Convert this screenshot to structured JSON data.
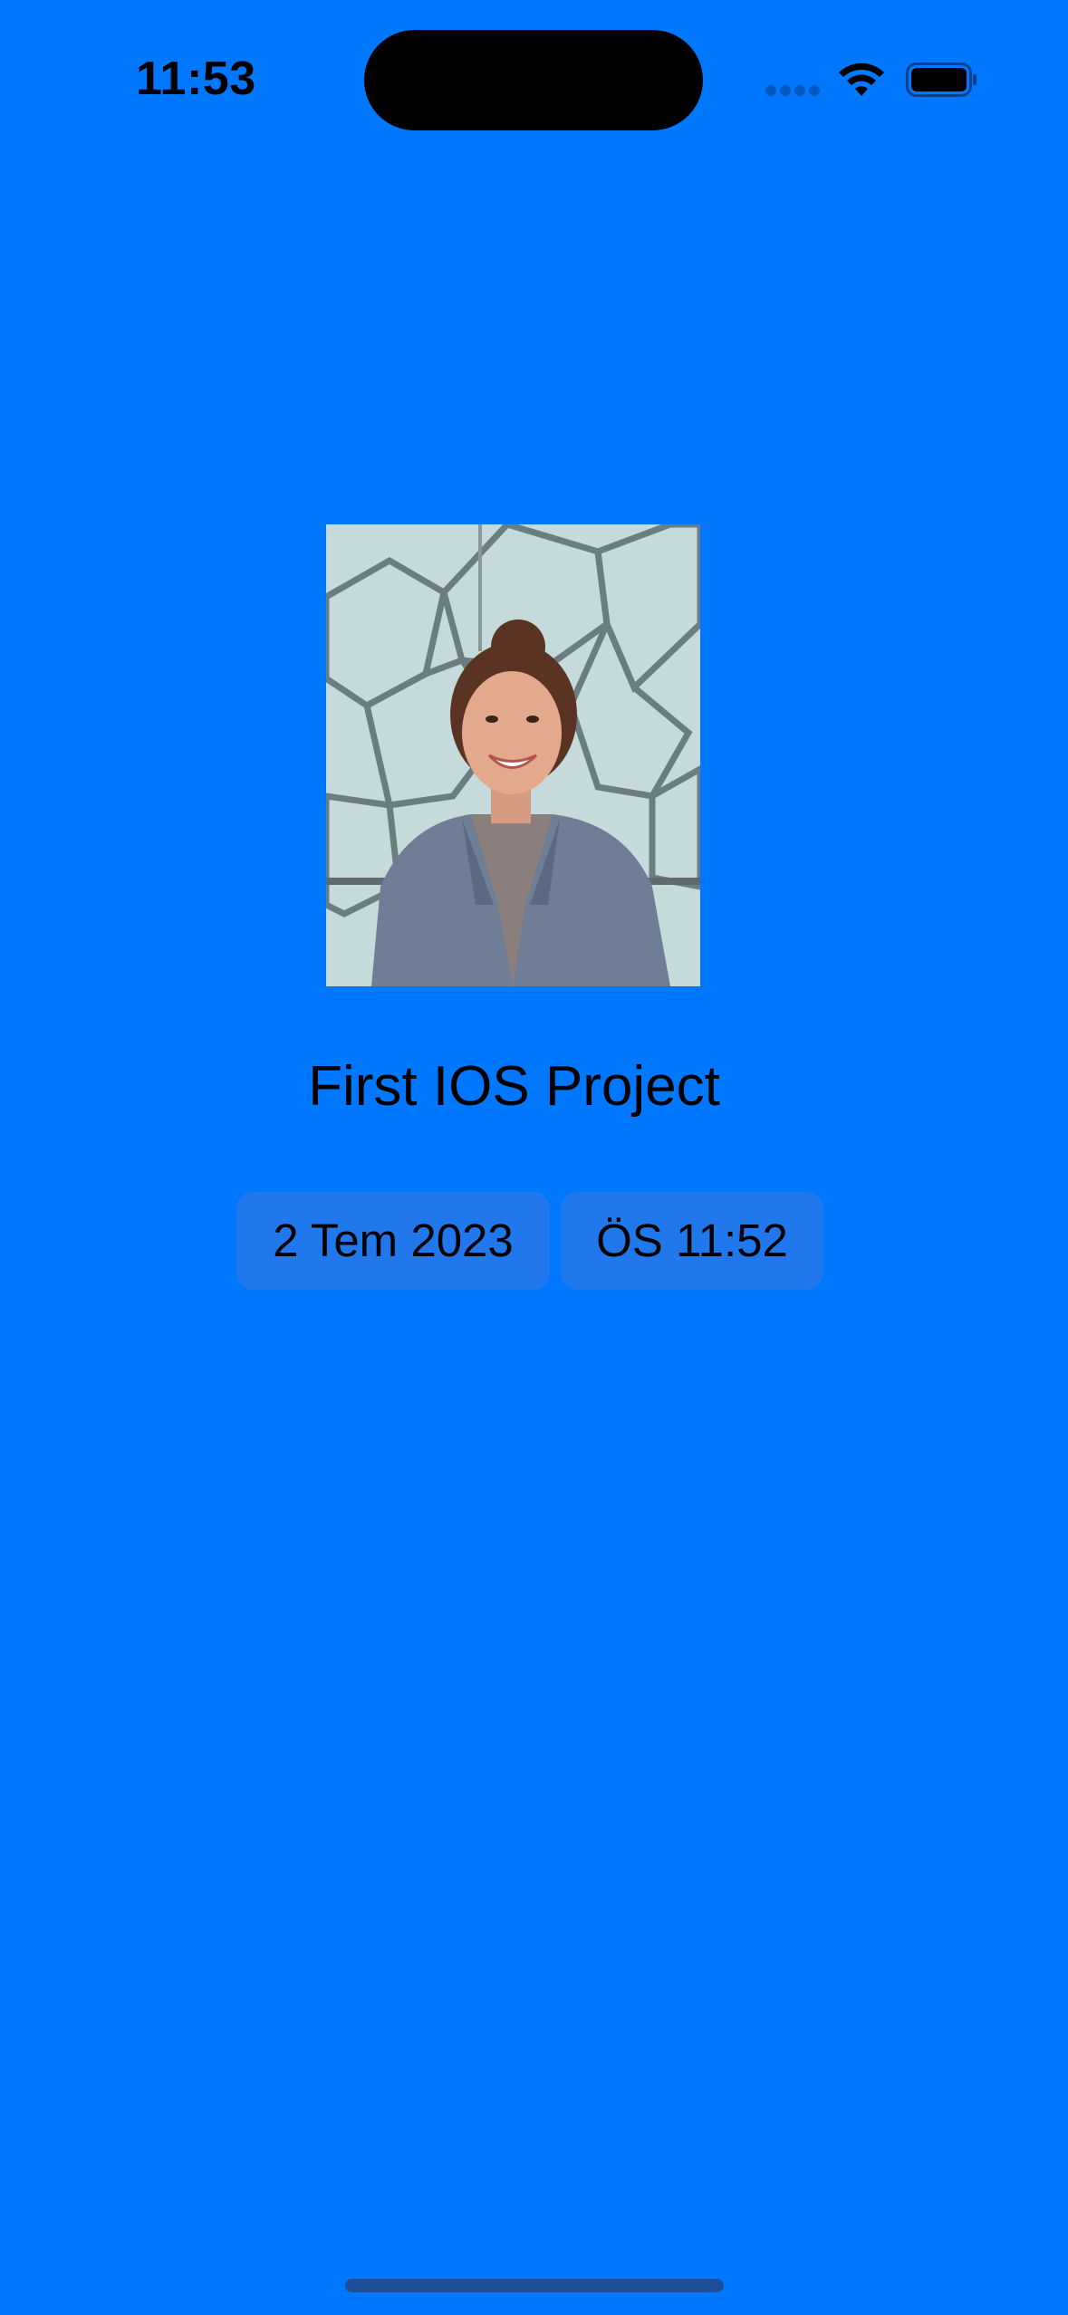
{
  "status_bar": {
    "time": "11:53",
    "icons": [
      "signal-icon",
      "wifi-icon",
      "battery-icon"
    ]
  },
  "colors": {
    "background": "#0077FF",
    "pill_background": "#3C78DC",
    "home_indicator": "#1D4E9A"
  },
  "main": {
    "photo": "profile-photo",
    "title": "First IOS Project",
    "date_picker": {
      "date": "2 Tem 2023",
      "time": "ÖS 11:52"
    }
  }
}
